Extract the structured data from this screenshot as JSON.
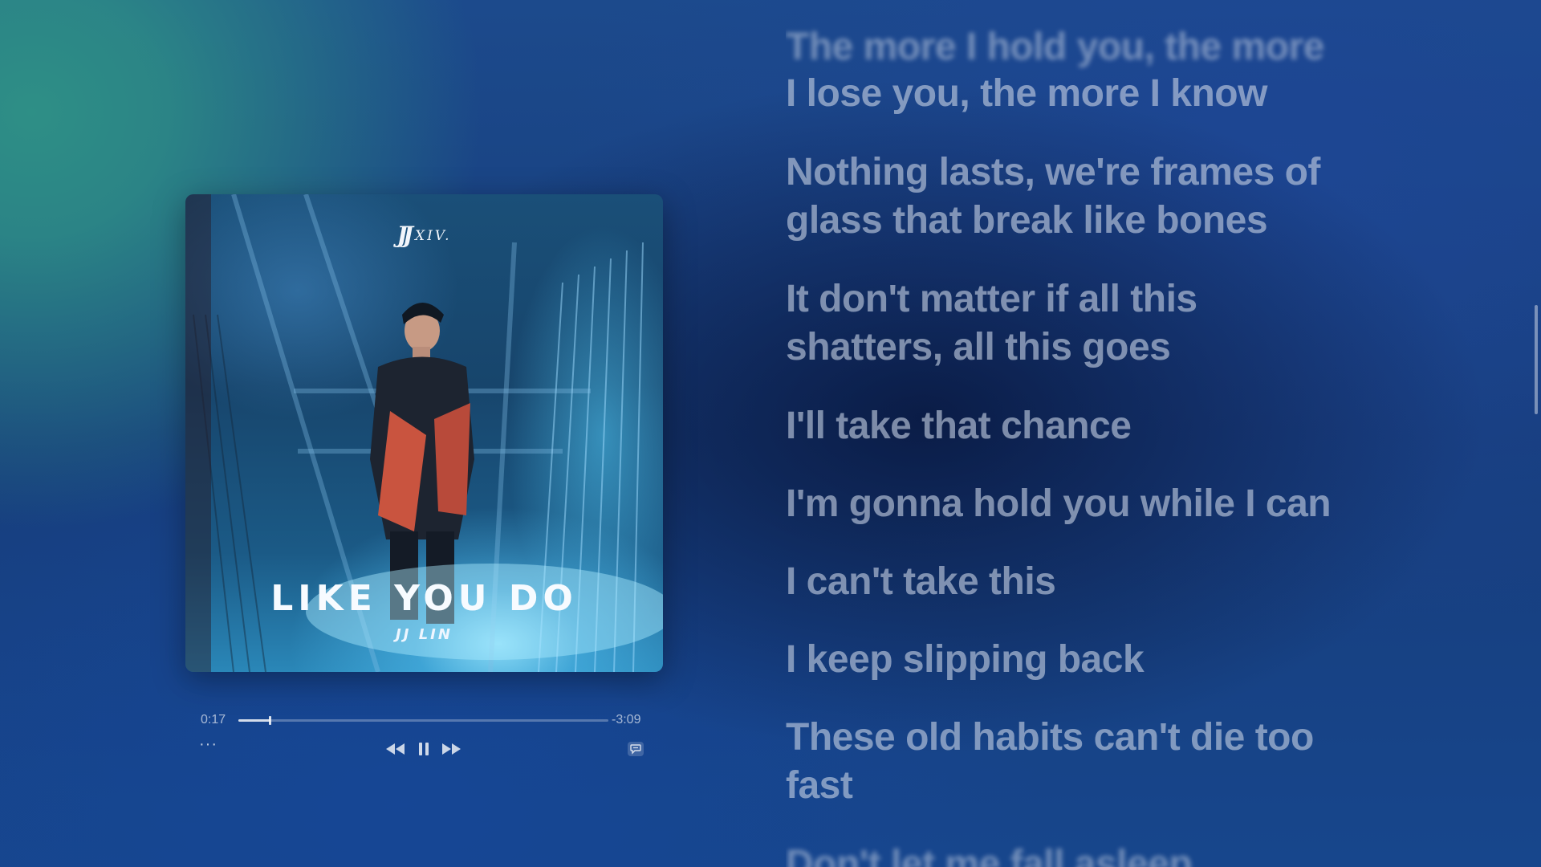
{
  "player": {
    "album_art": {
      "logo_text": "XIV.",
      "logo_mark": "JJ",
      "title": "LIKE YOU DO",
      "artist": "JJ LIN"
    },
    "elapsed": "0:17",
    "remaining": "-3:09",
    "progress_fraction": 0.085,
    "more_label": "···",
    "controls": {
      "rewind_icon": "rewind-icon",
      "pause_icon": "pause-icon",
      "forward_icon": "fast-forward-icon",
      "lyrics_icon": "lyrics-icon"
    }
  },
  "lyrics": [
    {
      "text": "The more I hold you, the more",
      "partially_visible": true
    },
    {
      "text": "I lose you, the more I know"
    },
    {
      "text": "Nothing lasts, we're frames of glass that break like bones"
    },
    {
      "text": "It don't matter if all this shatters, all this goes"
    },
    {
      "text": "I'll take that chance"
    },
    {
      "text": "I'm gonna hold you while I can"
    },
    {
      "text": "I can't take this"
    },
    {
      "text": "I keep slipping back"
    },
    {
      "text": "These old habits can't die too fast"
    },
    {
      "text": "Don't let me fall asleep",
      "partially_visible": true
    }
  ],
  "colors": {
    "background_teal": "#2e8f86",
    "background_blue": "#173d7c",
    "lyric_text": "#c4cee2"
  }
}
